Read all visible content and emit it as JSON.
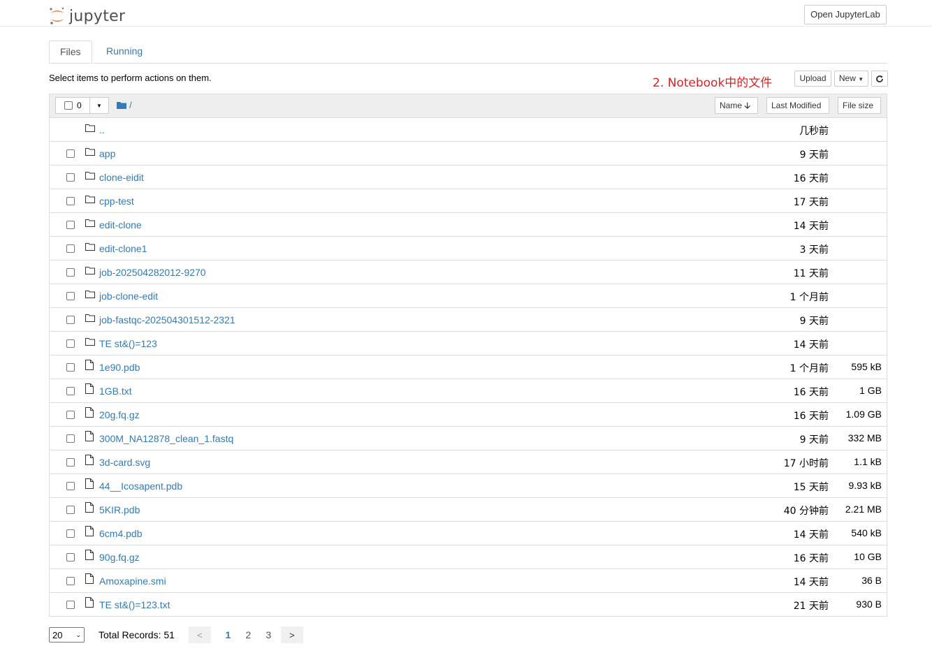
{
  "header": {
    "logo_text": "jupyter",
    "open_lab_label": "Open JupyterLab"
  },
  "tabs": [
    {
      "label": "Files",
      "active": true
    },
    {
      "label": "Running",
      "active": false
    }
  ],
  "toolbar": {
    "instructions": "Select items to perform actions on them.",
    "annotation": "2. Notebook中的文件",
    "upload_label": "Upload",
    "new_label": "New",
    "refresh_icon": "refresh-icon"
  },
  "list_header": {
    "selected_count": "0",
    "path": "/",
    "sort_name_label": "Name",
    "last_modified_label": "Last Modified",
    "file_size_label": "File size"
  },
  "parent_row": {
    "name": "..",
    "modified": "几秒前"
  },
  "items": [
    {
      "type": "folder",
      "name": "app",
      "modified": "9 天前",
      "size": ""
    },
    {
      "type": "folder",
      "name": "clone-eidit",
      "modified": "16 天前",
      "size": ""
    },
    {
      "type": "folder",
      "name": "cpp-test",
      "modified": "17 天前",
      "size": ""
    },
    {
      "type": "folder",
      "name": "edit-clone",
      "modified": "14 天前",
      "size": ""
    },
    {
      "type": "folder",
      "name": "edit-clone1",
      "modified": "3 天前",
      "size": ""
    },
    {
      "type": "folder",
      "name": "job-202504282012-9270",
      "modified": "11 天前",
      "size": ""
    },
    {
      "type": "folder",
      "name": "job-clone-edit",
      "modified": "1 个月前",
      "size": ""
    },
    {
      "type": "folder",
      "name": "job-fastqc-202504301512-2321",
      "modified": "9 天前",
      "size": ""
    },
    {
      "type": "folder",
      "name": "TE st&()=123",
      "modified": "14 天前",
      "size": ""
    },
    {
      "type": "file",
      "name": "1e90.pdb",
      "modified": "1 个月前",
      "size": "595 kB"
    },
    {
      "type": "file",
      "name": "1GB.txt",
      "modified": "16 天前",
      "size": "1 GB"
    },
    {
      "type": "file",
      "name": "20g.fq.gz",
      "modified": "16 天前",
      "size": "1.09 GB"
    },
    {
      "type": "file",
      "name": "300M_NA12878_clean_1.fastq",
      "modified": "9 天前",
      "size": "332 MB"
    },
    {
      "type": "file",
      "name": "3d-card.svg",
      "modified": "17 小时前",
      "size": "1.1 kB"
    },
    {
      "type": "file",
      "name": "44__Icosapent.pdb",
      "modified": "15 天前",
      "size": "9.93 kB"
    },
    {
      "type": "file",
      "name": "5KIR.pdb",
      "modified": "40 分钟前",
      "size": "2.21 MB"
    },
    {
      "type": "file",
      "name": "6cm4.pdb",
      "modified": "14 天前",
      "size": "540 kB"
    },
    {
      "type": "file",
      "name": "90g.fq.gz",
      "modified": "16 天前",
      "size": "10 GB"
    },
    {
      "type": "file",
      "name": "Amoxapine.smi",
      "modified": "14 天前",
      "size": "36 B"
    },
    {
      "type": "file",
      "name": "TE st&()=123.txt",
      "modified": "21 天前",
      "size": "930 B"
    }
  ],
  "pager": {
    "page_size": "20",
    "total_label": "Total Records: 51",
    "prev_label": "<",
    "next_label": ">",
    "pages": [
      "1",
      "2",
      "3"
    ],
    "current_page": "1"
  },
  "colors": {
    "link": "#337ab7",
    "annotation": "#e02020",
    "header_bg": "#eeeeee"
  }
}
